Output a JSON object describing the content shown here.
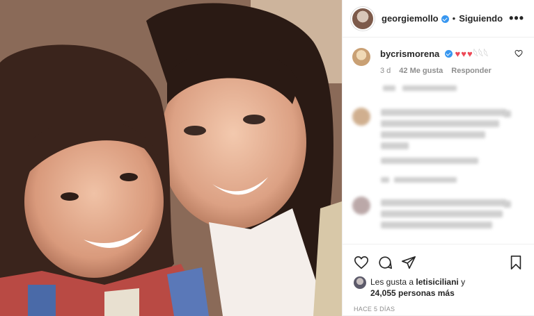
{
  "post": {
    "username": "georgiemollo",
    "separator": "•",
    "follow_status": "Siguiendo",
    "more_label": "•••"
  },
  "comment": {
    "username": "bycrismorena",
    "text_hearts": "♥♥♥",
    "text_extra": "𓆩𓆩𓆩",
    "age": "3 d",
    "likes": "42 Me gusta",
    "reply": "Responder"
  },
  "likes": {
    "prefix": "Les gusta a",
    "user": "letisiciliani",
    "suffix": "y",
    "count": "24,055 personas más"
  },
  "time_ago": "HACE 5 DÍAS",
  "colors": {
    "verified": "#3897f0",
    "hearts": "#ed4956",
    "muted": "#8e8e8e"
  },
  "icons": {
    "like": "heart-outline-icon",
    "comment": "comment-bubble-icon",
    "share": "paper-plane-icon",
    "save": "bookmark-icon"
  }
}
